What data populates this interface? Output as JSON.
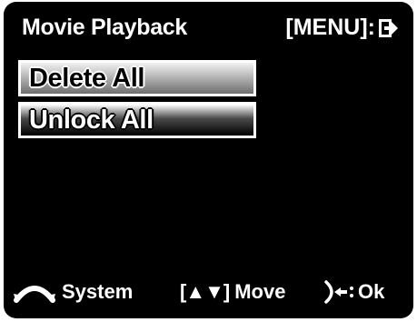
{
  "header": {
    "title": "Movie Playback",
    "menu_hint_label": "[MENU]:",
    "exit_icon": "exit-icon"
  },
  "menu": {
    "items": [
      {
        "label": "Delete All",
        "selected": true
      },
      {
        "label": "Unlock All",
        "selected": false
      }
    ]
  },
  "footer": {
    "system_icon": "mode-dial-icon",
    "system_label": "System",
    "move_arrows": "[▲▼]",
    "move_label": "Move",
    "ok_icon": "shutter-button-icon",
    "ok_label": "Ok"
  },
  "colors": {
    "background": "#000000",
    "text": "#ffffff",
    "selected_text": "#000000"
  }
}
